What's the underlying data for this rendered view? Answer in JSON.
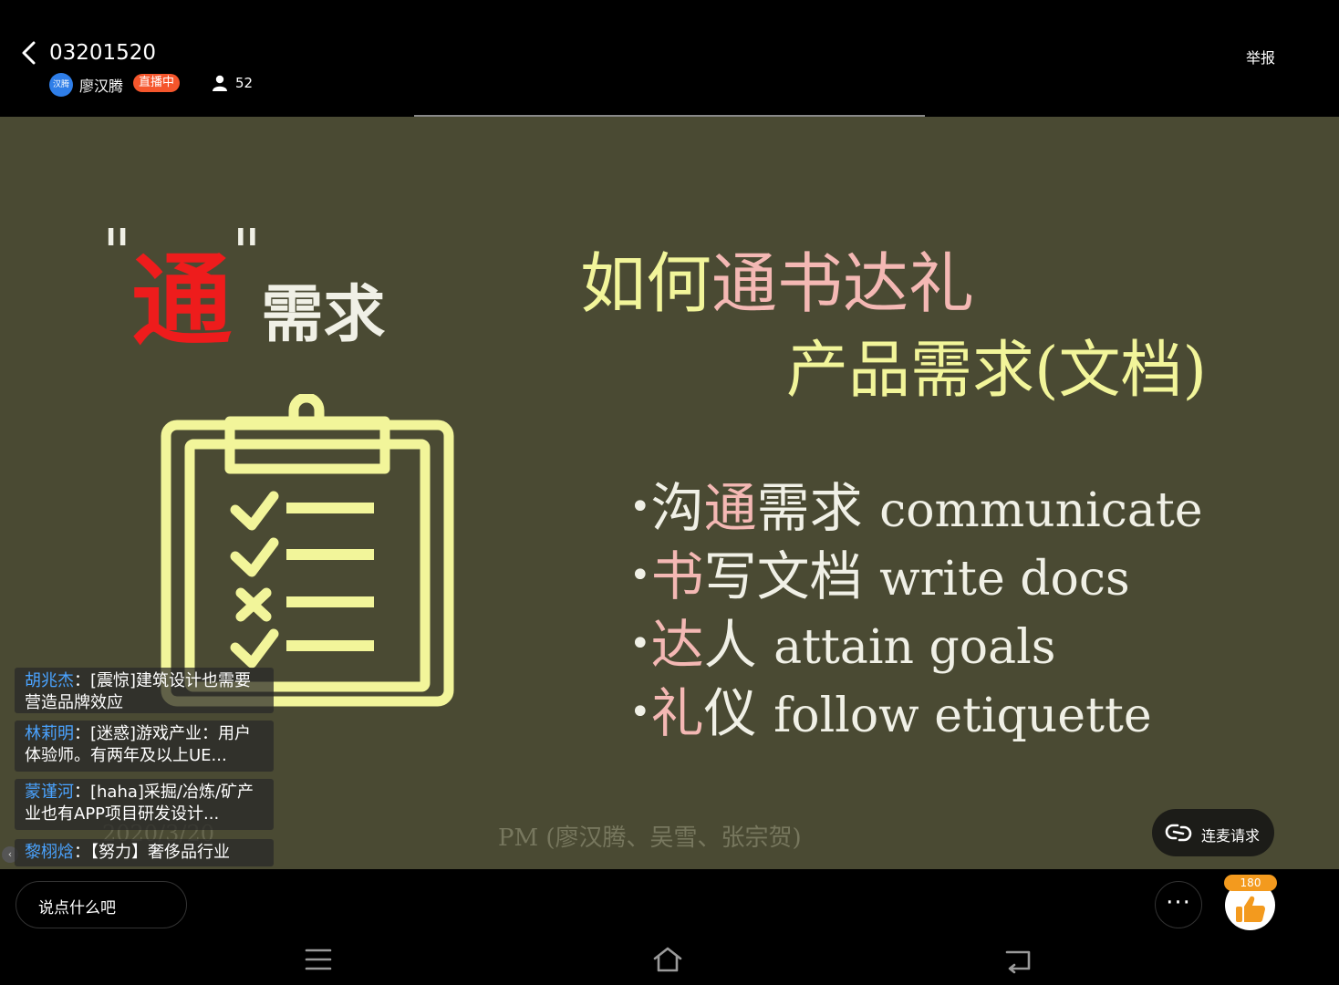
{
  "header": {
    "room_id": "03201520",
    "host_avatar_text": "汉腾",
    "host_name": "廖汉腾",
    "live_badge": "直播中",
    "viewer_count": "52",
    "report_label": "举报"
  },
  "slide": {
    "left_title_quote_open": "\"",
    "left_title_highlight": "通",
    "left_title_quote_close": "\"",
    "left_title_rest": "需求",
    "right_title_1a": "如何",
    "right_title_1b": "通书达礼",
    "right_title_2": "产品需求(文档)",
    "bullets": [
      {
        "pre": "沟",
        "hl": "通",
        "post": "需求",
        "en": "communicate"
      },
      {
        "pre": "",
        "hl": "书",
        "post": "写文档",
        "en": "write docs"
      },
      {
        "pre": "",
        "hl": "达",
        "post": "人",
        "en": "attain goals"
      },
      {
        "pre": "",
        "hl": "礼",
        "post": "仪",
        "en": "follow etiquette"
      }
    ],
    "footer": "PM (廖汉腾、吴雪、张宗贺)",
    "date_watermark": "2020/3/20"
  },
  "comments": [
    {
      "user": "胡兆杰",
      "sep": "：",
      "text": "[震惊]建筑设计也需要营造品牌效应"
    },
    {
      "user": "林莉明",
      "sep": "：",
      "text": "[迷惑]游戏产业：用户体验师。有两年及以上UE..."
    },
    {
      "user": "蒙谨河",
      "sep": "：",
      "text": "[haha]采掘/冶炼/矿产业也有APP项目研发设计..."
    },
    {
      "user": "黎栩焓",
      "sep": "：",
      "text": "【努力】奢侈品行业"
    }
  ],
  "mic_request_label": "连麦请求",
  "chat_placeholder": "说点什么吧",
  "more_label": "···",
  "like_count": "180",
  "colors": {
    "slide_bg": "#4a4a33",
    "accent_yellow": "#f2f59a",
    "accent_pink": "#f4b8b4",
    "accent_red": "#ee1c1c",
    "username_blue": "#4aa3ff",
    "live_badge": "#f5562c",
    "like_badge": "#f39a1e"
  },
  "icons": [
    "back-arrow-icon",
    "user-icon",
    "clipboard-checklist-icon",
    "mic-link-icon",
    "thumbs-up-icon",
    "menu-icon",
    "home-icon",
    "return-icon"
  ]
}
